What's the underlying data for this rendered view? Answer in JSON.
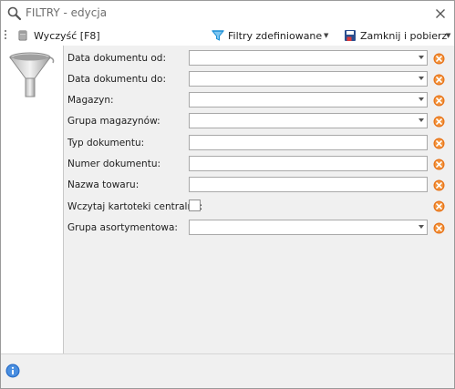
{
  "window": {
    "title": "FILTRY - edycja",
    "close_glyph": "✕"
  },
  "toolbar": {
    "clear_label": "Wyczyść [F8]",
    "clear_icon": "eraser-icon",
    "predefined_label": "Filtry zdefiniowane",
    "predefined_icon": "funnel-icon",
    "predefined_caret": "▼",
    "close_fetch_label": "Zamknij i pobierz",
    "close_fetch_icon": "save-close-icon",
    "close_fetch_caret": "▼"
  },
  "colors": {
    "clear_button": "#e8741a",
    "funnel_blue": "#1a8fd6",
    "info_blue": "#2a6fc9"
  },
  "filters": [
    {
      "label": "Data dokumentu od:",
      "type": "dropdown",
      "value": ""
    },
    {
      "label": "Data dokumentu do:",
      "type": "dropdown",
      "value": ""
    },
    {
      "label": "Magazyn:",
      "type": "dropdown",
      "value": ""
    },
    {
      "label": "Grupa magazynów:",
      "type": "dropdown",
      "value": ""
    },
    {
      "label": "Typ dokumentu:",
      "type": "text",
      "value": ""
    },
    {
      "label": "Numer dokumentu:",
      "type": "text",
      "value": ""
    },
    {
      "label": "Nazwa towaru:",
      "type": "text",
      "value": ""
    },
    {
      "label": "Wczytaj kartoteki centralne:",
      "type": "checkbox",
      "checked": false
    },
    {
      "label": "Grupa asortymentowa:",
      "type": "dropdown",
      "value": ""
    }
  ]
}
